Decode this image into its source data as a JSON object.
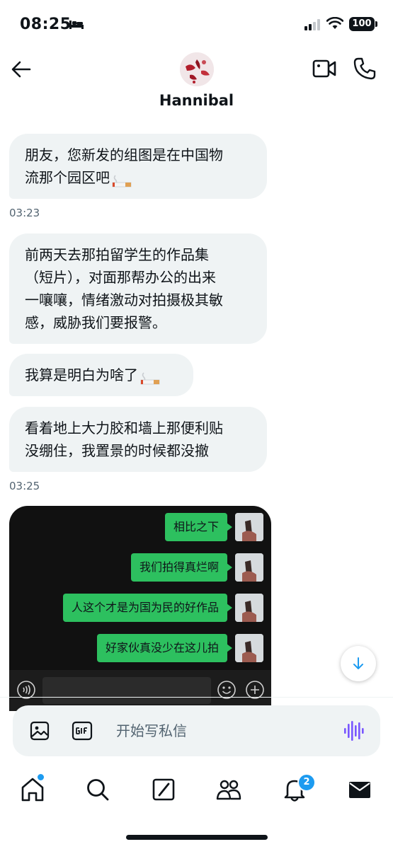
{
  "status_bar": {
    "time": "08:25",
    "battery": "100"
  },
  "header": {
    "contact_name": "Hannibal"
  },
  "messages": [
    {
      "text": "朋友，您新发的组图是在中国物\n流那个园区吧",
      "emoji": "cigarette"
    },
    {
      "text": "前两天去那拍留学生的作品集\n（短片），对面那帮办公的出来\n一嚷嚷，情绪激动对拍摄极其敏\n感，威胁我们要报警。"
    },
    {
      "text": "我算是明白为啥了",
      "emoji": "cigarette"
    },
    {
      "text": "看着地上大力胶和墙上那便利贴\n没绷住，我置景的时候都没撤"
    }
  ],
  "timestamps": [
    "03:23",
    "03:25"
  ],
  "embedded_chat": {
    "messages": [
      "相比之下",
      "我们拍得真烂啊",
      "人这个才是为国为民的好作品",
      "好家伙真没少在这儿拍"
    ]
  },
  "composer": {
    "placeholder": "开始写私信"
  },
  "nav": {
    "notification_count": "2"
  },
  "colors": {
    "accent": "#1d9bf0",
    "bubble_bg": "#eff3f4",
    "wechat_green": "#2dc05f",
    "voice_purple": "#7856ff"
  }
}
